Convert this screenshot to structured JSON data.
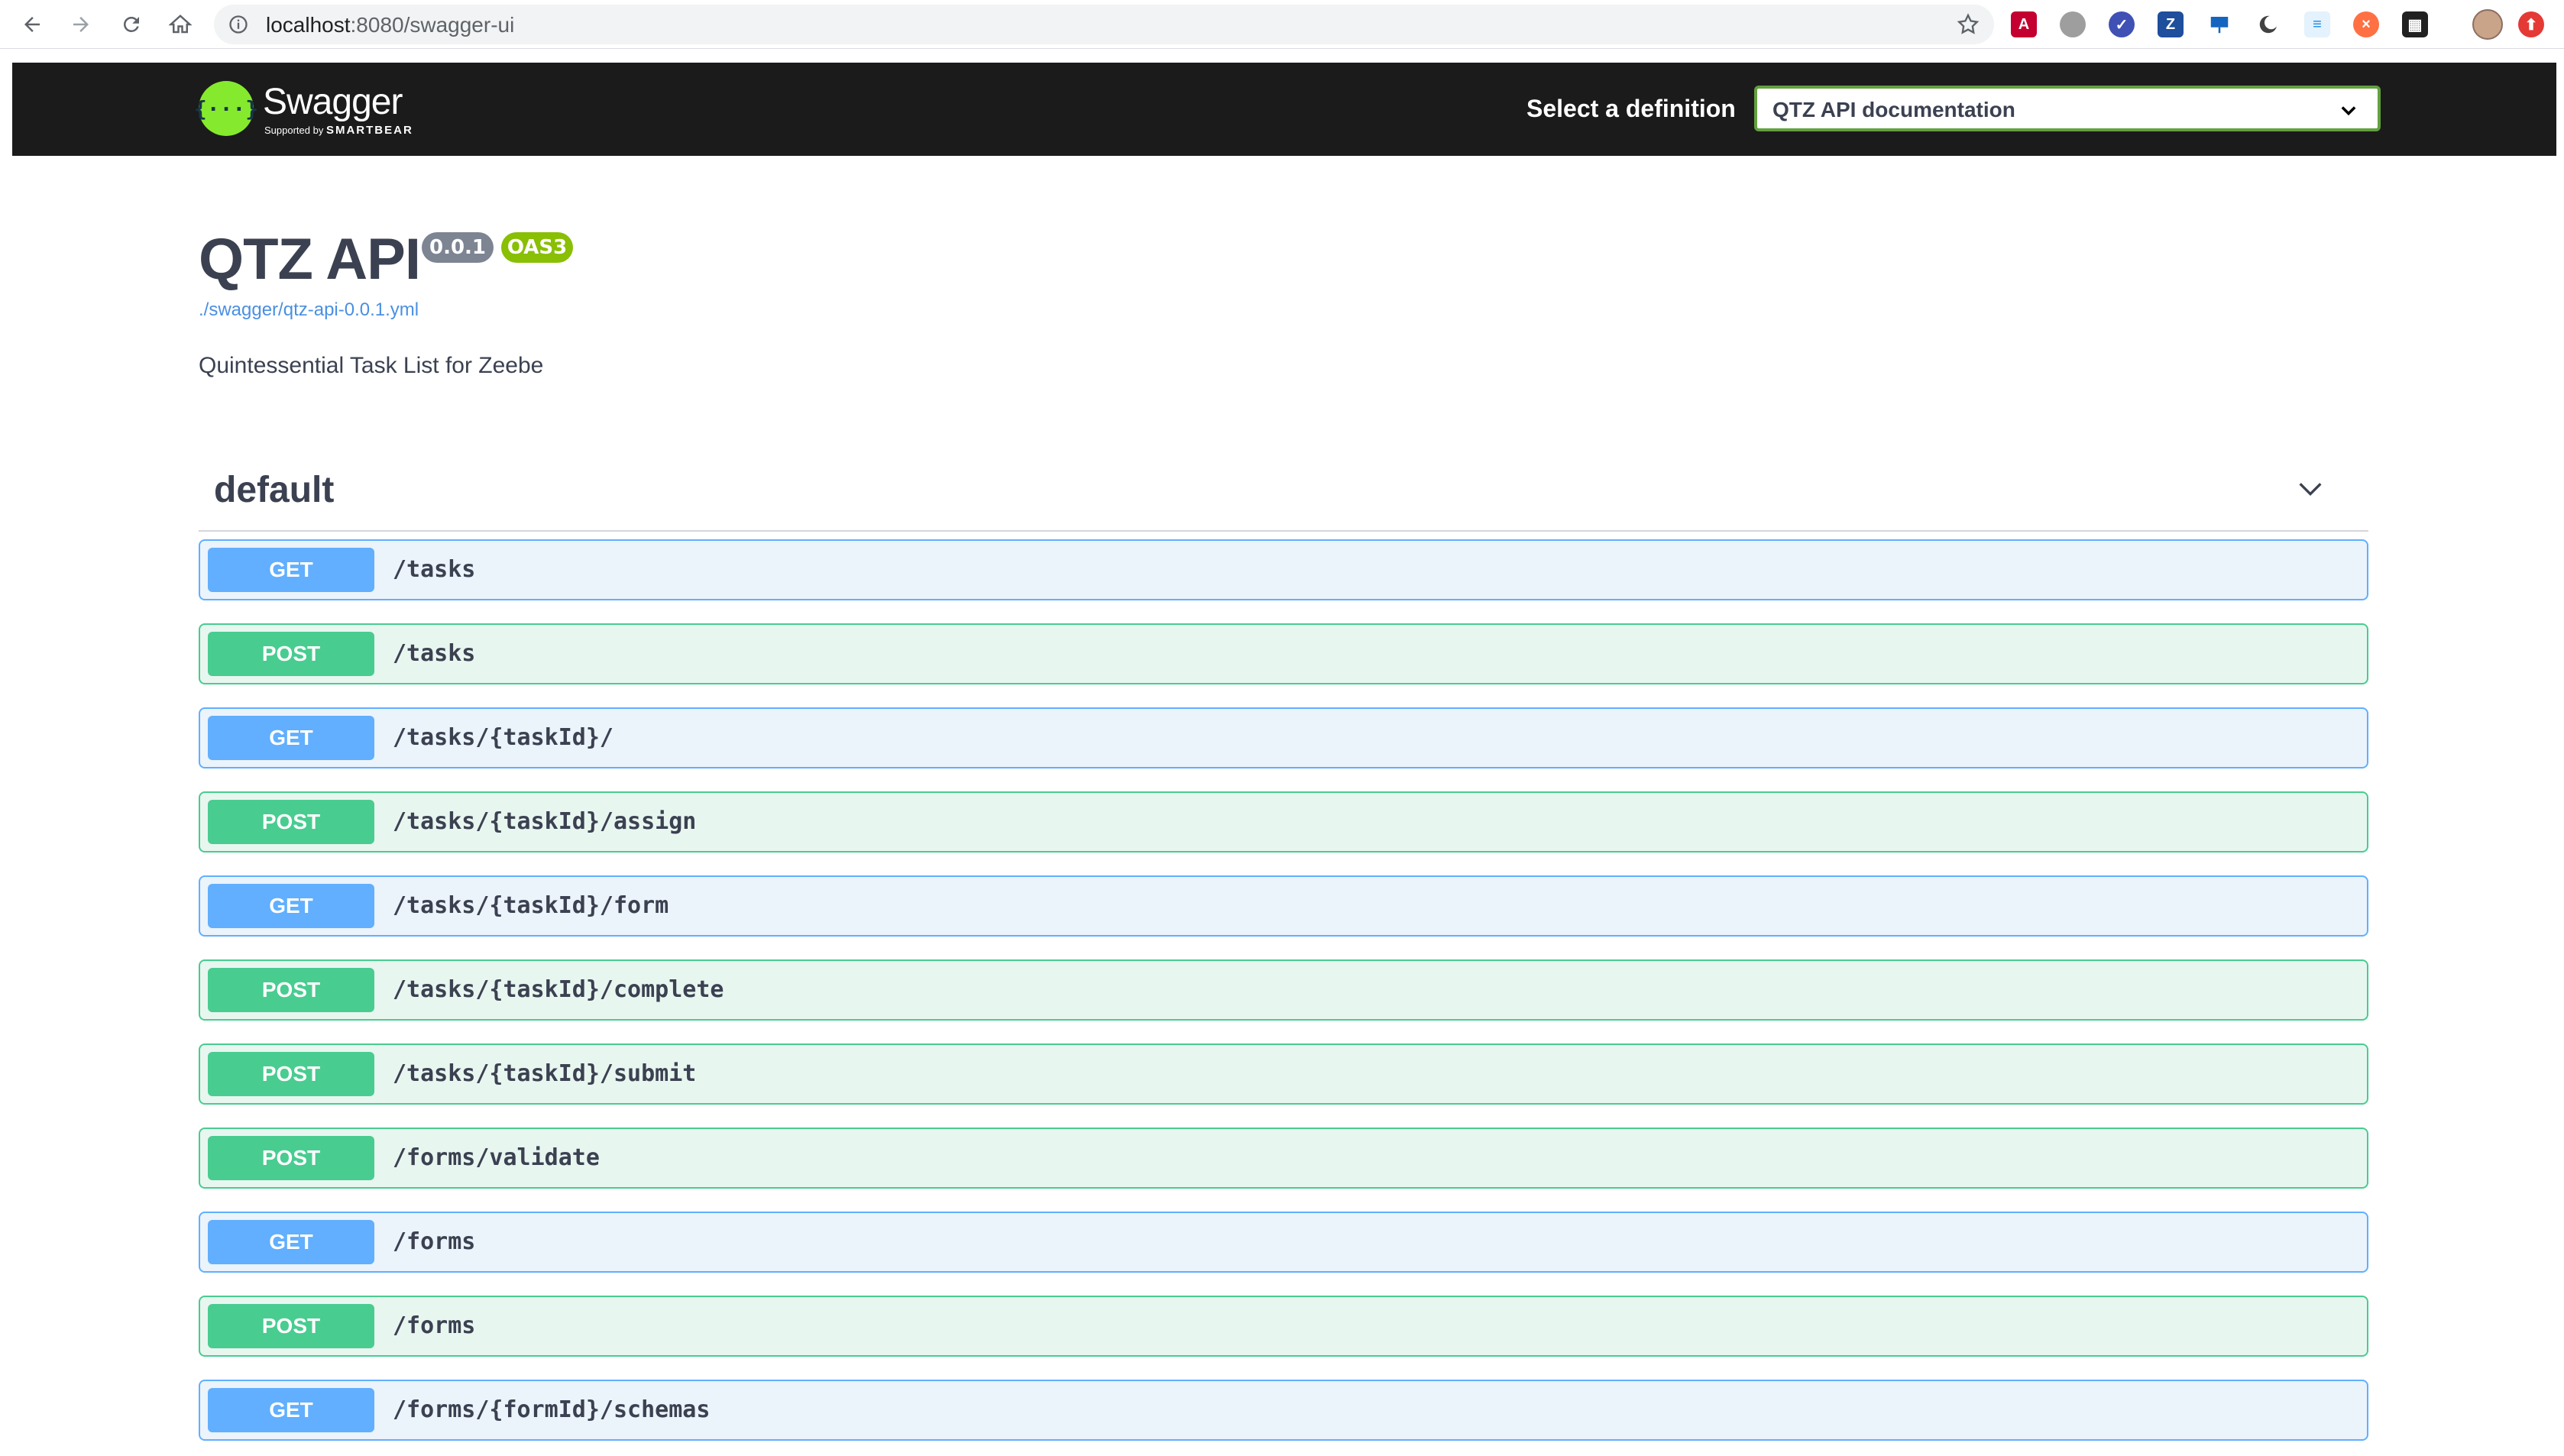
{
  "browser": {
    "url_host": "localhost",
    "url_path": ":8080/swagger-ui"
  },
  "topbar": {
    "logo_mark": "{···}",
    "logo_text": "Swagger",
    "logo_sub_prefix": "Supported by",
    "logo_sub_brand": "SMARTBEAR",
    "definition_label": "Select a definition",
    "definition_value": "QTZ API documentation"
  },
  "info": {
    "title": "QTZ API",
    "version": "0.0.1",
    "oas": "OAS3",
    "spec_url": "./swagger/qtz-api-0.0.1.yml",
    "description": "Quintessential Task List for Zeebe"
  },
  "tag": {
    "name": "default"
  },
  "operations": [
    {
      "method": "GET",
      "path": "/tasks"
    },
    {
      "method": "POST",
      "path": "/tasks"
    },
    {
      "method": "GET",
      "path": "/tasks/{taskId}/"
    },
    {
      "method": "POST",
      "path": "/tasks/{taskId}/assign"
    },
    {
      "method": "GET",
      "path": "/tasks/{taskId}/form"
    },
    {
      "method": "POST",
      "path": "/tasks/{taskId}/complete"
    },
    {
      "method": "POST",
      "path": "/tasks/{taskId}/submit"
    },
    {
      "method": "POST",
      "path": "/forms/validate"
    },
    {
      "method": "GET",
      "path": "/forms"
    },
    {
      "method": "POST",
      "path": "/forms"
    },
    {
      "method": "GET",
      "path": "/forms/{formId}/schemas"
    }
  ],
  "colors": {
    "get": "#61affe",
    "post": "#49cc90",
    "swagger_green": "#85ea2d",
    "topbar": "#1b1b1b"
  },
  "icons": {
    "back": "arrow-left-icon",
    "forward": "arrow-right-icon",
    "reload": "reload-icon",
    "home": "home-icon",
    "info": "info-icon",
    "bookmark": "star-icon",
    "collapse": "chevron-down-icon"
  }
}
